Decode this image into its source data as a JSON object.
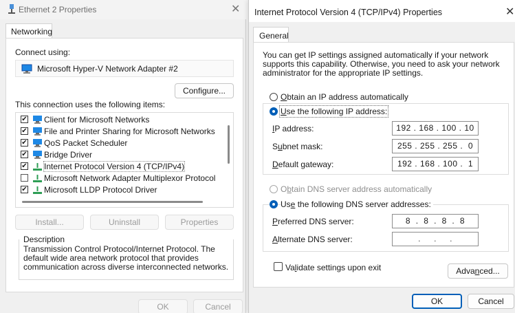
{
  "colors": {
    "accent": "#005fb8",
    "network_green": "#2e9e55",
    "monitor_blue": "#1e88e5"
  },
  "back_dialog": {
    "title": "Ethernet 2 Properties",
    "close_glyph": "✕",
    "tab": "Networking",
    "connect_using_label": "Connect using:",
    "adapter_name": "Microsoft Hyper-V Network Adapter #2",
    "configure_button": "Configure...",
    "items_label": "This connection uses the following items:",
    "items": [
      {
        "label": "Client for Microsoft Networks",
        "checked": "✔",
        "icon": "network-client-icon"
      },
      {
        "label": "File and Printer Sharing for Microsoft Networks",
        "checked": "✔",
        "icon": "file-printer-sharing-icon"
      },
      {
        "label": "QoS Packet Scheduler",
        "checked": "✔",
        "icon": "qos-scheduler-icon"
      },
      {
        "label": "Bridge Driver",
        "checked": "✔",
        "icon": "bridge-driver-icon"
      },
      {
        "label": "Internet Protocol Version 4 (TCP/IPv4)",
        "checked": "✔",
        "icon": "protocol-icon"
      },
      {
        "label": "Microsoft Network Adapter Multiplexor Protocol",
        "checked": "",
        "icon": "protocol-icon"
      },
      {
        "label": "Microsoft LLDP Protocol Driver",
        "checked": "✔",
        "icon": "protocol-icon"
      }
    ],
    "install_button": "Install...",
    "uninstall_button": "Uninstall",
    "properties_button": "Properties",
    "description_label": "Description",
    "description_text": "Transmission Control Protocol/Internet Protocol. The default wide area network protocol that provides communication across diverse interconnected networks.",
    "ok_button": "OK",
    "cancel_button": "Cancel"
  },
  "front_dialog": {
    "title": "Internet Protocol Version 4 (TCP/IPv4) Properties",
    "close_glyph": "✕",
    "tab": "General",
    "intro_text": "You can get IP settings assigned automatically if your network supports this capability. Otherwise, you need to ask your network administrator for the appropriate IP settings.",
    "ip_auto": {
      "accel": "O",
      "rest": "btain an IP address automatically"
    },
    "ip_manual": {
      "accel": "U",
      "rest": "se the following IP address:"
    },
    "ip_address": {
      "accel": "I",
      "rest": "P address:",
      "value": "192 . 168 . 100 . 10"
    },
    "subnet_mask": {
      "pre": "S",
      "accel": "u",
      "rest": "bnet mask:",
      "value": "255 . 255 . 255 .  0"
    },
    "default_gateway": {
      "accel": "D",
      "rest": "efault gateway:",
      "value": "192 . 168 . 100 .  1"
    },
    "dns_auto": {
      "pre": "O",
      "accel": "b",
      "rest": "tain DNS server address automatically"
    },
    "dns_manual": {
      "pre": "Us",
      "accel": "e",
      "rest": " the following DNS server addresses:"
    },
    "preferred_dns": {
      "accel": "P",
      "rest": "referred DNS server:",
      "value": "8  .  8  .  8  .  8"
    },
    "alternate_dns": {
      "accel": "A",
      "rest": "lternate DNS server:",
      "value": ".     .     ."
    },
    "validate": {
      "pre": "Va",
      "accel": "l",
      "rest": "idate settings upon exit",
      "checked": false
    },
    "advanced_button": {
      "pre": "Adva",
      "accel": "n",
      "rest": "ced..."
    },
    "ok_button": "OK",
    "cancel_button": "Cancel"
  }
}
